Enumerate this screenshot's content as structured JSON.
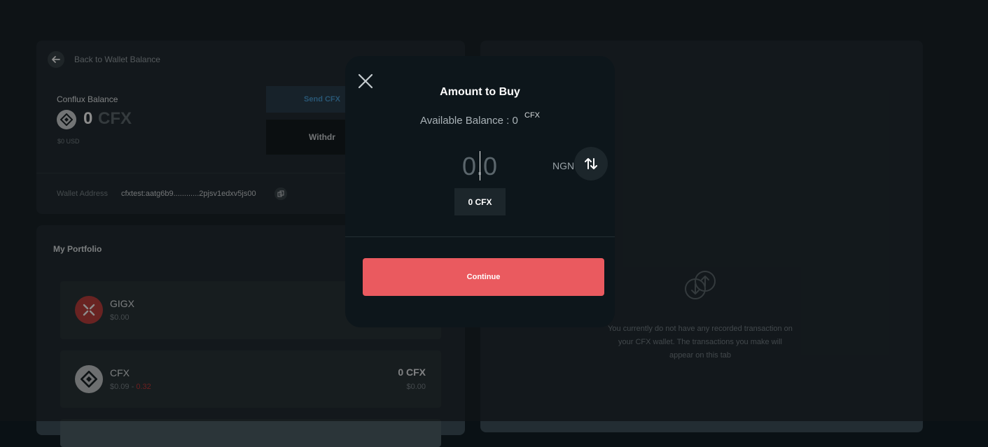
{
  "wallet": {
    "back_label": "Back to Wallet Balance",
    "balance_title": "Conflux Balance",
    "balance_amount": "0",
    "balance_unit": "CFX",
    "balance_usd": "$0 USD",
    "send_label": "Send CFX",
    "withdraw_label": "Withdr",
    "address_label": "Wallet Address",
    "address_value": "cfxtest:aatg6b9............2pjsv1edxv5js00"
  },
  "portfolio": {
    "title": "My Portfolio",
    "assets": [
      {
        "name": "GIGX",
        "price": "$0.00",
        "change": "",
        "amount": "",
        "value": ""
      },
      {
        "name": "CFX",
        "price": "$0.09 - ",
        "change": "0.32",
        "amount": "0 CFX",
        "value": "$0.00"
      }
    ]
  },
  "transactions": {
    "empty_text": "You currently do not have any recorded transaction on your CFX wallet. The transactions you make will appear on this tab"
  },
  "modal": {
    "title": "Amount to Buy",
    "available_label": "Available Balance : 0",
    "available_unit": "CFX",
    "amount_placeholder": "0.0",
    "currency": "NGN",
    "equivalent": "0 CFX",
    "continue_label": "Continue"
  },
  "colors": {
    "accent": "#ea5a5f",
    "background": "#0a1115",
    "modal_bg": "#0d161b",
    "negative": "#c43a3a",
    "link_blue": "#4a9dd3"
  },
  "icons": [
    "back-arrow-icon",
    "conflux-logo-icon",
    "copy-icon",
    "gigx-logo-icon",
    "transaction-empty-icon",
    "close-icon",
    "swap-icon"
  ]
}
